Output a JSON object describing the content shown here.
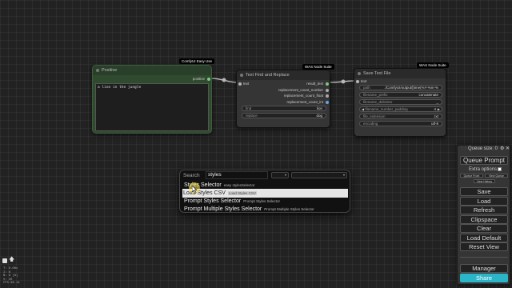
{
  "nodes": {
    "positive": {
      "title": "Positive",
      "badge": "ComfyUI Easy Use",
      "output_label": "positive",
      "text": "a lion in the jungle",
      "color": "#2f4a2f"
    },
    "find_replace": {
      "title": "Text Find and Replace",
      "badge": "WAS Node Suite",
      "input_label": "text",
      "outputs": [
        "result_text",
        "replacement_count_number",
        "replacement_count_float",
        "replacement_count_int"
      ],
      "find_label": "find",
      "find_value": "lion",
      "replace_label": "replace",
      "replace_value": "dog"
    },
    "save_text": {
      "title": "Save Text File",
      "badge": "WAS Node Suite",
      "input_label": "text",
      "widgets": [
        {
          "label": "path",
          "value": "./ComfyUI/output/[time(%Y-%m-%"
        },
        {
          "label": "filename_prefix",
          "value": "concatenate"
        },
        {
          "label": "filename_delimiter",
          "value": "_"
        },
        {
          "label": "filename_number_padding",
          "value": "4"
        },
        {
          "label": "file_extension",
          "value": ".txt"
        },
        {
          "label": "encoding",
          "value": "utf-8"
        }
      ]
    }
  },
  "search": {
    "label": "Search",
    "query": "styles",
    "results": [
      {
        "name": "Styles Selector",
        "desc": "easy stylesSelector"
      },
      {
        "name": "Load Styles CSV",
        "desc": "Load Styles CSV"
      },
      {
        "name": "Prompt Styles Selector",
        "desc": "Prompt Styles Selector"
      },
      {
        "name": "Prompt Multiple Styles Selector",
        "desc": "Prompt Multiple Styles Selector"
      }
    ]
  },
  "menu": {
    "queue_size": "Queue size: 0",
    "queue_prompt": "Queue Prompt",
    "extra_options": "Extra options",
    "queue_front": "Queue Front",
    "view_queue": "View Queue",
    "view_history": "View History",
    "save": "Save",
    "load": "Load",
    "refresh": "Refresh",
    "clipspace": "Clipspace",
    "clear": "Clear",
    "load_default": "Load Default",
    "reset_view": "Reset View",
    "manager": "Manager",
    "share": "Share",
    "share_color": "#2bb5c9"
  },
  "stats": [
    "T: 0.00s",
    "I: 0",
    "N: 0 [0]",
    "V: 26",
    "FPS:58.14"
  ],
  "colors": {
    "link": "#b7b7b7",
    "output_port": "#7ec97e",
    "int_port": "#6aa0e0"
  }
}
